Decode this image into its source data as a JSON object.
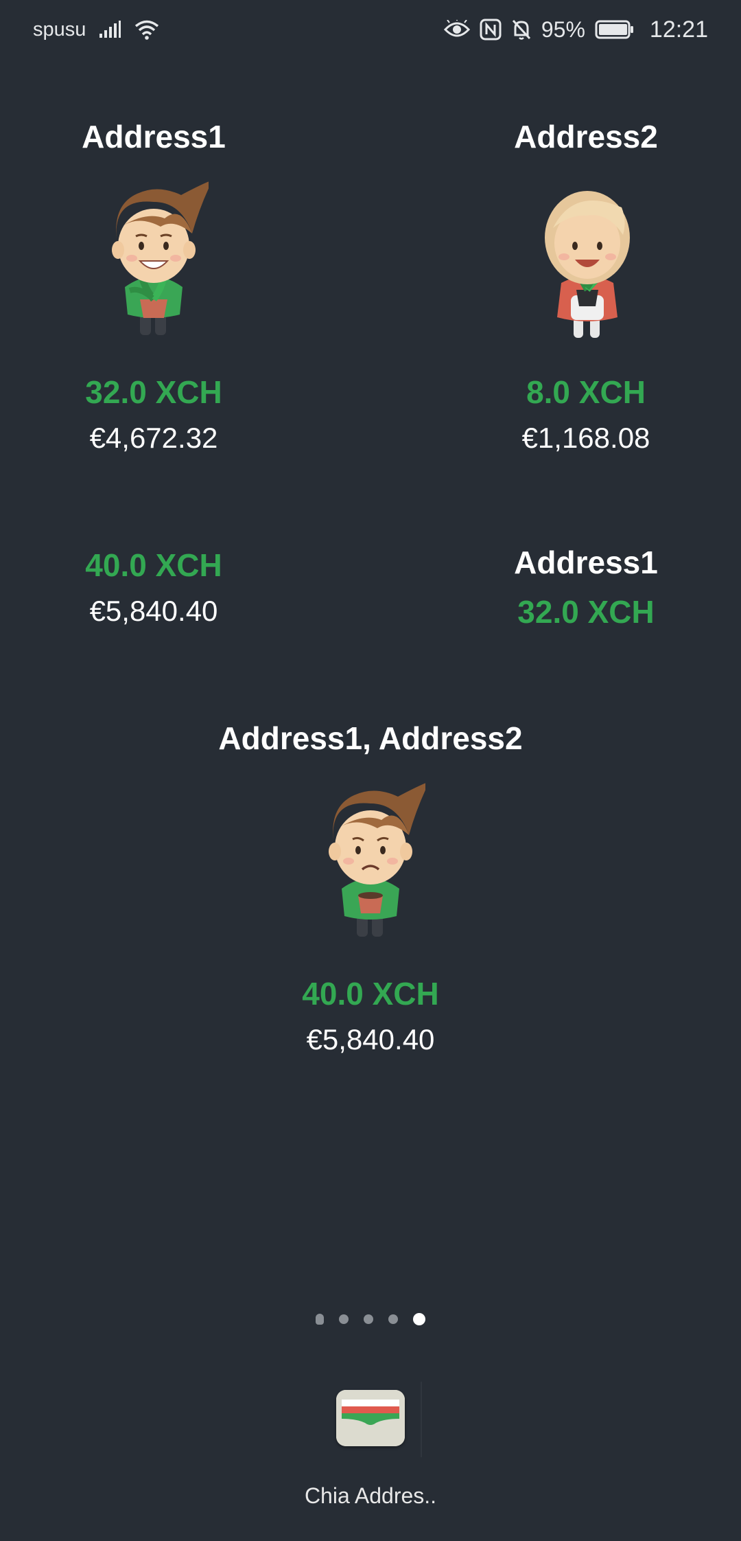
{
  "status_bar": {
    "carrier": "spusu",
    "battery": "95%",
    "time": "12:21"
  },
  "widgets": {
    "address1": {
      "title": "Address1",
      "xch": "32.0 XCH",
      "eur": "€4,672.32"
    },
    "address2": {
      "title": "Address2",
      "xch": "8.0 XCH",
      "eur": "€1,168.08"
    },
    "total": {
      "xch": "40.0 XCH",
      "eur": "€5,840.40"
    },
    "compact": {
      "title": "Address1",
      "xch": "32.0 XCH"
    },
    "combined": {
      "title": "Address1, Address2",
      "xch": "40.0 XCH",
      "eur": "€5,840.40"
    }
  },
  "pager": {
    "count": 5,
    "active": 5
  },
  "dock": {
    "app_label": "Chia Addres.."
  },
  "colors": {
    "background": "#272d35",
    "xch_green": "#33a852",
    "text": "#ffffff"
  },
  "icons": {
    "signal": "signal-icon",
    "wifi": "wifi-icon",
    "eye": "eye-comfort-icon",
    "nfc": "nfc-icon",
    "bell_off": "bell-off-icon",
    "battery": "battery-icon"
  }
}
